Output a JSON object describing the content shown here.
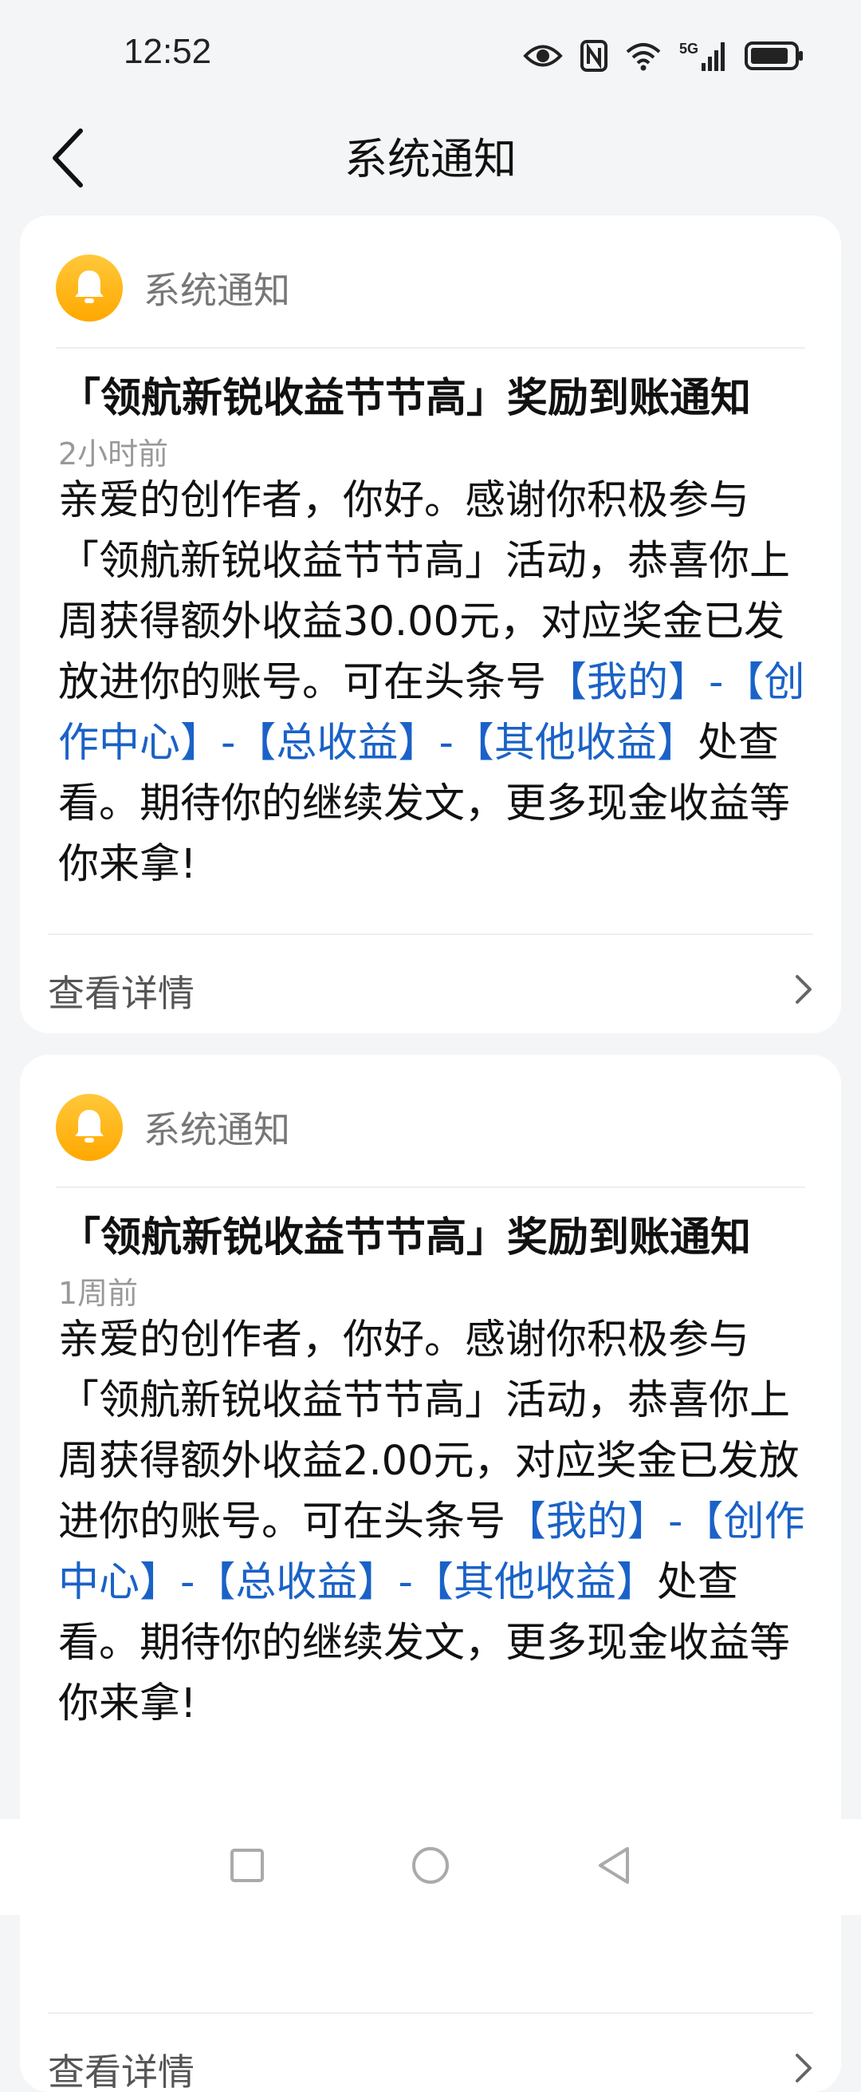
{
  "status_bar": {
    "time": "12:52",
    "icons": [
      "eye-icon",
      "nfc-icon",
      "wifi-icon",
      "5g-signal-icon",
      "battery-icon"
    ],
    "network_label": "5G"
  },
  "top_bar": {
    "title": "系统通知",
    "back_icon": "chevron-left-icon"
  },
  "notifications": [
    {
      "header_label": "系统通知",
      "title": "「领航新锐收益节节高」奖励到账通知",
      "time": "2小时前",
      "body_intro": "亲爱的创作者，你好。感谢你积极参与「领航新锐收益节节高」活动，恭喜你上周获得额外收益30.00元，对应奖金已发放进你的账号。可在头条号",
      "link_mine": "【我的】",
      "sep1": "-",
      "link_creation": "【创作中心】",
      "sep2": "-",
      "link_total": "【总收益】",
      "sep3": "-",
      "link_other": "【其他收益】",
      "body_outro": "处查看。期待你的继续发文，更多现金收益等你来拿!",
      "details_label": "查看详情"
    },
    {
      "header_label": "系统通知",
      "title": "「领航新锐收益节节高」奖励到账通知",
      "time": "1周前",
      "body_intro": "亲爱的创作者，你好。感谢你积极参与「领航新锐收益节节高」活动，恭喜你上周获得额外收益2.00元，对应奖金已发放进你的账号。可在头条号",
      "link_mine": "【我的】",
      "sep1": "-",
      "link_creation": "【创作中心】",
      "sep2": "-",
      "link_total": "【总收益】",
      "sep3": "-",
      "link_other": "【其他收益】",
      "body_outro": "处查看。期待你的继续发文，更多现金收益等你来拿!",
      "details_label": "查看详情"
    }
  ],
  "colors": {
    "background": "#f4f5f7",
    "link": "#1a62c7",
    "bell": "#ffb300",
    "meta": "#999999"
  }
}
